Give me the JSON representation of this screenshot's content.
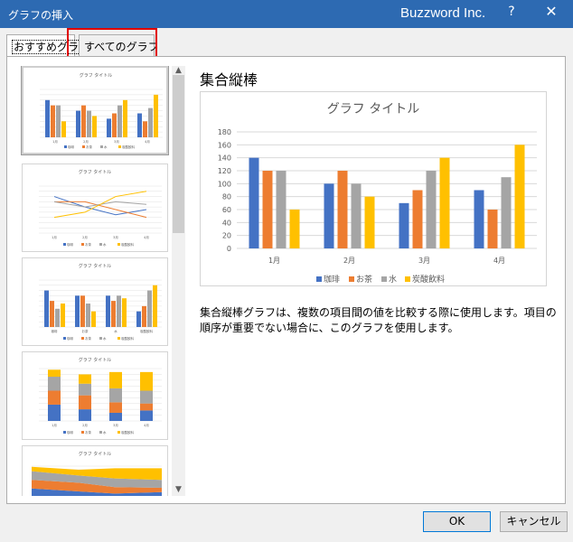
{
  "window": {
    "title": "グラフの挿入",
    "brand": "Buzzword Inc.",
    "help": "?",
    "close": "✕"
  },
  "tabs": [
    {
      "label": "おすすめグラフ"
    },
    {
      "label": "すべてのグラフ"
    }
  ],
  "preview": {
    "heading": "集合縦棒",
    "description": "集合縦棒グラフは、複数の項目間の値を比較する際に使用します。項目の順序が重要でない場合に、このグラフを使用します。"
  },
  "buttons": {
    "ok": "OK",
    "cancel": "キャンセル"
  },
  "colors": {
    "s1": "#4472c4",
    "s2": "#ed7d31",
    "s3": "#a5a5a5",
    "s4": "#ffc000",
    "titlebar": "#2d6ab2"
  },
  "thumb_labels": {
    "title": "グラフ タイトル",
    "legend": [
      "珈琲",
      "お茶",
      "水",
      "炭酸飲料"
    ]
  },
  "chart_data": {
    "type": "bar",
    "title": "グラフ タイトル",
    "categories": [
      "1月",
      "2月",
      "3月",
      "4月"
    ],
    "series": [
      {
        "name": "珈琲",
        "values": [
          140,
          100,
          70,
          90
        ]
      },
      {
        "name": "お茶",
        "values": [
          120,
          120,
          90,
          60
        ]
      },
      {
        "name": "水",
        "values": [
          120,
          100,
          120,
          110
        ]
      },
      {
        "name": "炭酸飲料",
        "values": [
          60,
          80,
          140,
          160
        ]
      }
    ],
    "ylim": [
      0,
      180
    ],
    "yticks": [
      "0",
      "20",
      "40",
      "60",
      "80",
      "100",
      "120",
      "140",
      "160",
      "180"
    ],
    "grid": true,
    "legend": "bottom"
  }
}
